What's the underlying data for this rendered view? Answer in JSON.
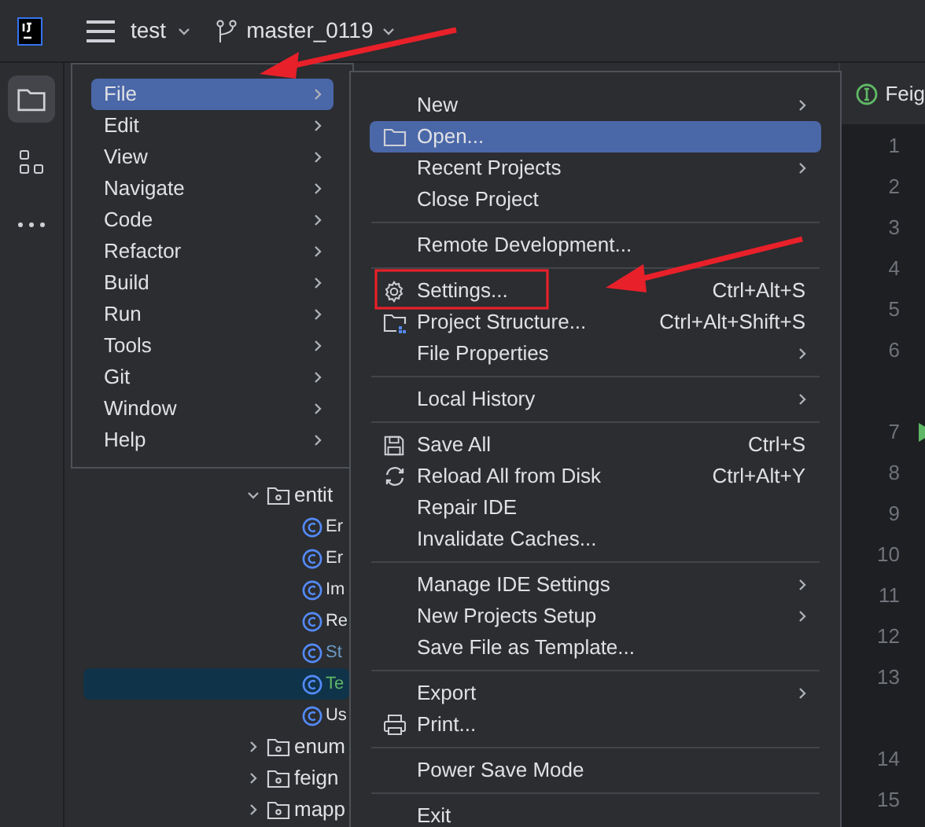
{
  "toolbar": {
    "project": "test",
    "branch": "master_0119"
  },
  "tool_strip": [
    {
      "kind": "folder",
      "selected": true
    },
    {
      "kind": "structure",
      "selected": false
    },
    {
      "kind": "more",
      "selected": false
    }
  ],
  "project_tree": [
    {
      "label": "entit",
      "kind": "folder",
      "expanded": true,
      "color": "#dfe1e5",
      "selected": false,
      "children": [
        {
          "label": "Er",
          "kind": "class",
          "color": "#dfe1e5",
          "selected": false
        },
        {
          "label": "Er",
          "kind": "class",
          "color": "#dfe1e5",
          "selected": false
        },
        {
          "label": "Im",
          "kind": "class",
          "color": "#dfe1e5",
          "selected": false
        },
        {
          "label": "Re",
          "kind": "class",
          "color": "#dfe1e5",
          "selected": false
        },
        {
          "label": "St",
          "kind": "class",
          "color": "#6c9bc6",
          "selected": false
        },
        {
          "label": "Te",
          "kind": "class",
          "color": "#5fb865",
          "selected": true
        },
        {
          "label": "Us",
          "kind": "class",
          "color": "#dfe1e5",
          "selected": false
        }
      ]
    },
    {
      "label": "enum",
      "kind": "folder",
      "expanded": false,
      "color": "#dfe1e5",
      "selected": false
    },
    {
      "label": "feign",
      "kind": "folder",
      "expanded": false,
      "color": "#dfe1e5",
      "selected": false
    },
    {
      "label": "mapp",
      "kind": "folder",
      "expanded": false,
      "color": "#dfe1e5",
      "selected": false
    }
  ],
  "editor": {
    "tab": "Feig",
    "lines": [
      {
        "kind": "line",
        "number": "1",
        "run": false
      },
      {
        "kind": "line",
        "number": "2",
        "run": false
      },
      {
        "kind": "line",
        "number": "3",
        "run": false
      },
      {
        "kind": "line",
        "number": "4",
        "run": false
      },
      {
        "kind": "line",
        "number": "5",
        "run": false
      },
      {
        "kind": "line",
        "number": "6",
        "run": false
      },
      {
        "kind": "blank"
      },
      {
        "kind": "line",
        "number": "7",
        "run": true
      },
      {
        "kind": "line",
        "number": "8",
        "run": false
      },
      {
        "kind": "line",
        "number": "9",
        "run": false
      },
      {
        "kind": "line",
        "number": "10",
        "run": false
      },
      {
        "kind": "line",
        "number": "11",
        "run": false
      },
      {
        "kind": "line",
        "number": "12",
        "run": false
      },
      {
        "kind": "line",
        "number": "13",
        "run": false
      },
      {
        "kind": "blank"
      },
      {
        "kind": "line",
        "number": "14",
        "run": false
      },
      {
        "kind": "line",
        "number": "15",
        "run": false
      }
    ]
  },
  "main_menu": [
    {
      "label": "File",
      "selected": true
    },
    {
      "label": "Edit",
      "selected": false
    },
    {
      "label": "View",
      "selected": false
    },
    {
      "label": "Navigate",
      "selected": false
    },
    {
      "label": "Code",
      "selected": false
    },
    {
      "label": "Refactor",
      "selected": false
    },
    {
      "label": "Build",
      "selected": false
    },
    {
      "label": "Run",
      "selected": false
    },
    {
      "label": "Tools",
      "selected": false
    },
    {
      "label": "Git",
      "selected": false
    },
    {
      "label": "Window",
      "selected": false
    },
    {
      "label": "Help",
      "selected": false
    }
  ],
  "file_menu": [
    {
      "kind": "plain",
      "label": "New",
      "submenu": true,
      "selected": false
    },
    {
      "kind": "folder",
      "label": "Open...",
      "selected": true
    },
    {
      "kind": "plain",
      "label": "Recent Projects",
      "submenu": true,
      "selected": false
    },
    {
      "kind": "plain",
      "label": "Close Project",
      "selected": false
    },
    {
      "kind": "separator"
    },
    {
      "kind": "plain",
      "label": "Remote Development...",
      "selected": false
    },
    {
      "kind": "separator"
    },
    {
      "kind": "gear",
      "label": "Settings...",
      "shortcut": "Ctrl+Alt+S",
      "selected": false
    },
    {
      "kind": "structure",
      "label": "Project Structure...",
      "shortcut": "Ctrl+Alt+Shift+S",
      "selected": false
    },
    {
      "kind": "plain",
      "label": "File Properties",
      "submenu": true,
      "selected": false
    },
    {
      "kind": "separator"
    },
    {
      "kind": "plain",
      "label": "Local History",
      "submenu": true,
      "selected": false
    },
    {
      "kind": "separator"
    },
    {
      "kind": "save",
      "label": "Save All",
      "shortcut": "Ctrl+S",
      "selected": false
    },
    {
      "kind": "reload",
      "label": "Reload All from Disk",
      "shortcut": "Ctrl+Alt+Y",
      "selected": false
    },
    {
      "kind": "plain",
      "label": "Repair IDE",
      "selected": false
    },
    {
      "kind": "plain",
      "label": "Invalidate Caches...",
      "selected": false
    },
    {
      "kind": "separator"
    },
    {
      "kind": "plain",
      "label": "Manage IDE Settings",
      "submenu": true,
      "selected": false
    },
    {
      "kind": "plain",
      "label": "New Projects Setup",
      "submenu": true,
      "selected": false
    },
    {
      "kind": "plain",
      "label": "Save File as Template...",
      "selected": false
    },
    {
      "kind": "separator"
    },
    {
      "kind": "plain",
      "label": "Export",
      "submenu": true,
      "selected": false
    },
    {
      "kind": "print",
      "label": "Print...",
      "selected": false
    },
    {
      "kind": "separator"
    },
    {
      "kind": "plain",
      "label": "Power Save Mode",
      "selected": false
    },
    {
      "kind": "separator"
    },
    {
      "kind": "plain",
      "label": "Exit",
      "selected": false
    }
  ]
}
